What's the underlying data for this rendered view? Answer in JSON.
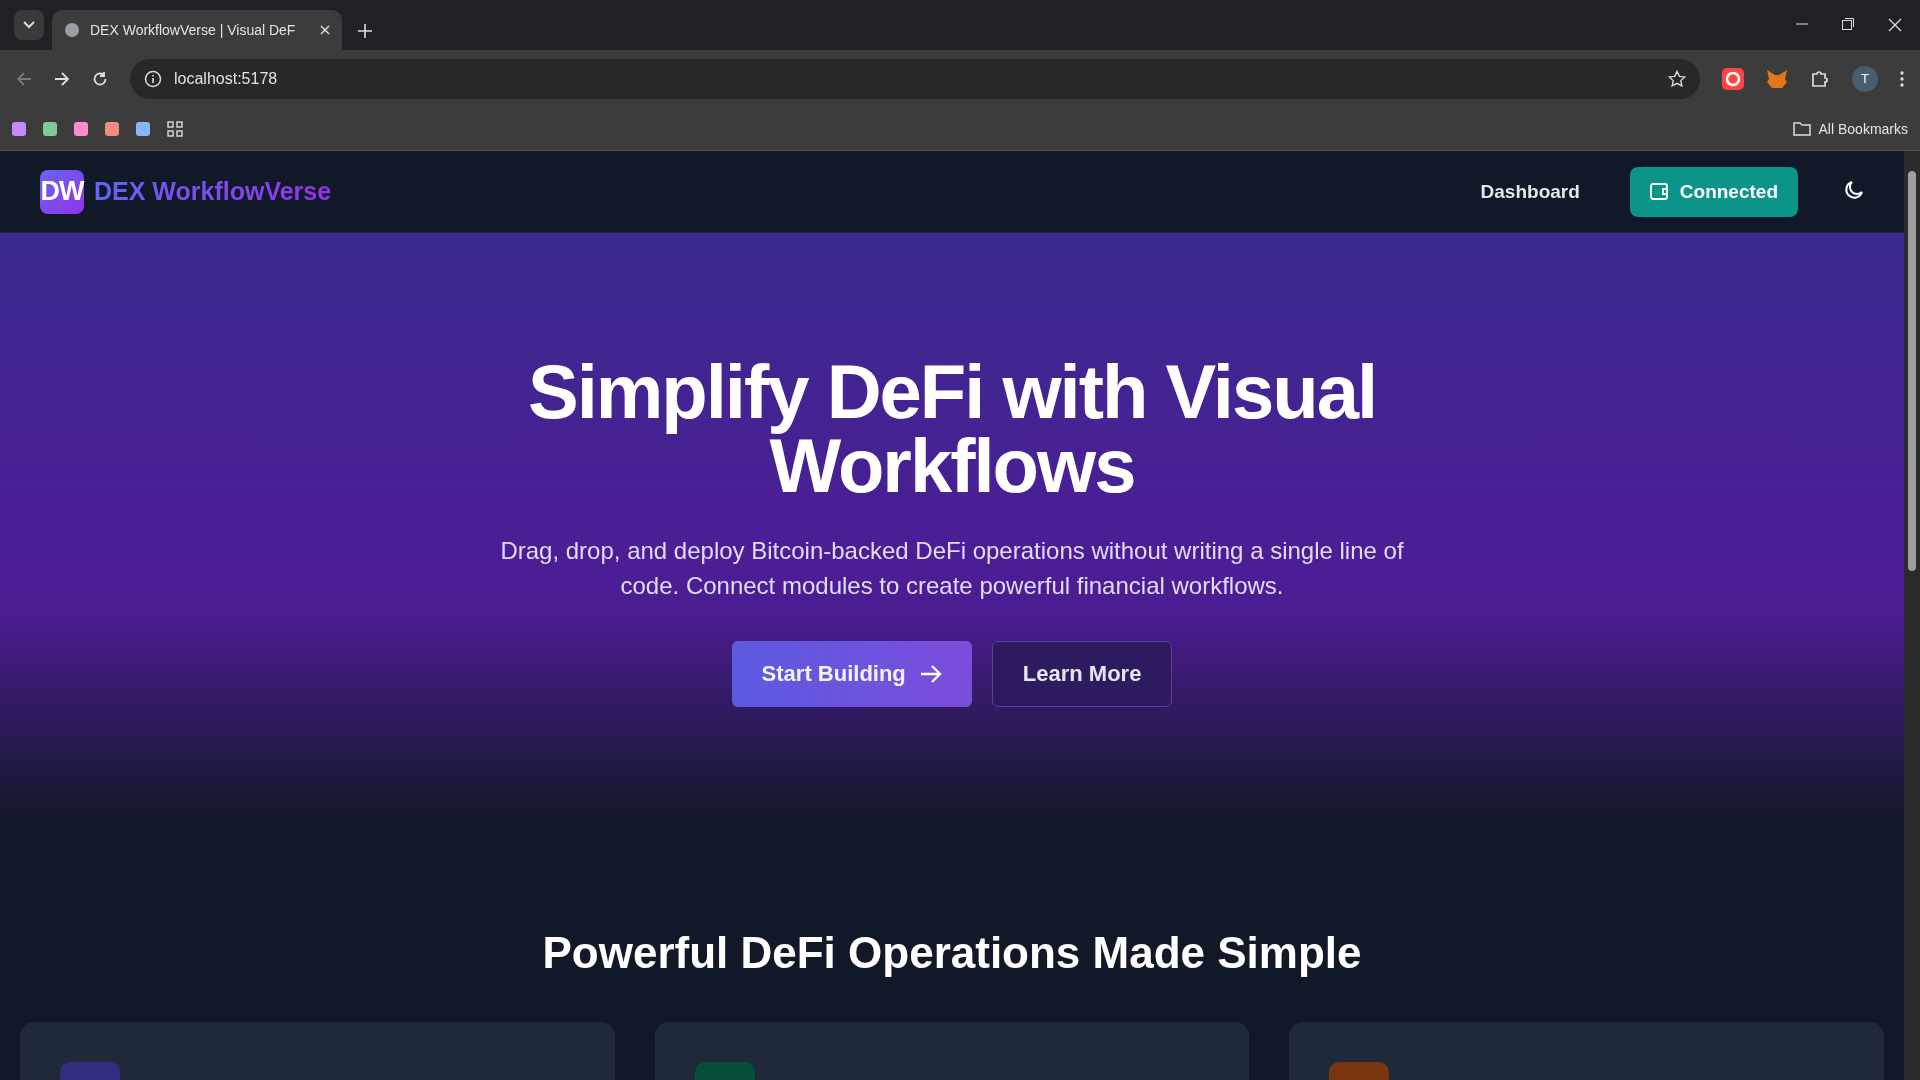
{
  "browser": {
    "tab_title": "DEX WorkflowVerse | Visual DeF",
    "url": "localhost:5178",
    "profile_initial": "T",
    "bookmarks_label": "All Bookmarks",
    "bookmarks": [
      {
        "color": "#c58af9"
      },
      {
        "color": "#81c995"
      },
      {
        "color": "#ff8bcb"
      },
      {
        "color": "#f28b82"
      },
      {
        "color": "#8ab4f8"
      }
    ]
  },
  "header": {
    "logo_mark": "DW",
    "brand": "DEX WorkflowVerse",
    "nav_link": "Dashboard",
    "wallet_button": "Connected"
  },
  "hero": {
    "title": "Simplify DeFi with Visual Workflows",
    "subtitle": "Drag, drop, and deploy Bitcoin-backed DeFi operations without writing a single line of code. Connect modules to create powerful financial workflows.",
    "primary_button": "Start Building",
    "secondary_button": "Learn More"
  },
  "features": {
    "heading": "Powerful DeFi Operations Made Simple",
    "cards": [
      {
        "color": "#312e81"
      },
      {
        "color": "#064e3b"
      },
      {
        "color": "#78350f"
      }
    ]
  }
}
